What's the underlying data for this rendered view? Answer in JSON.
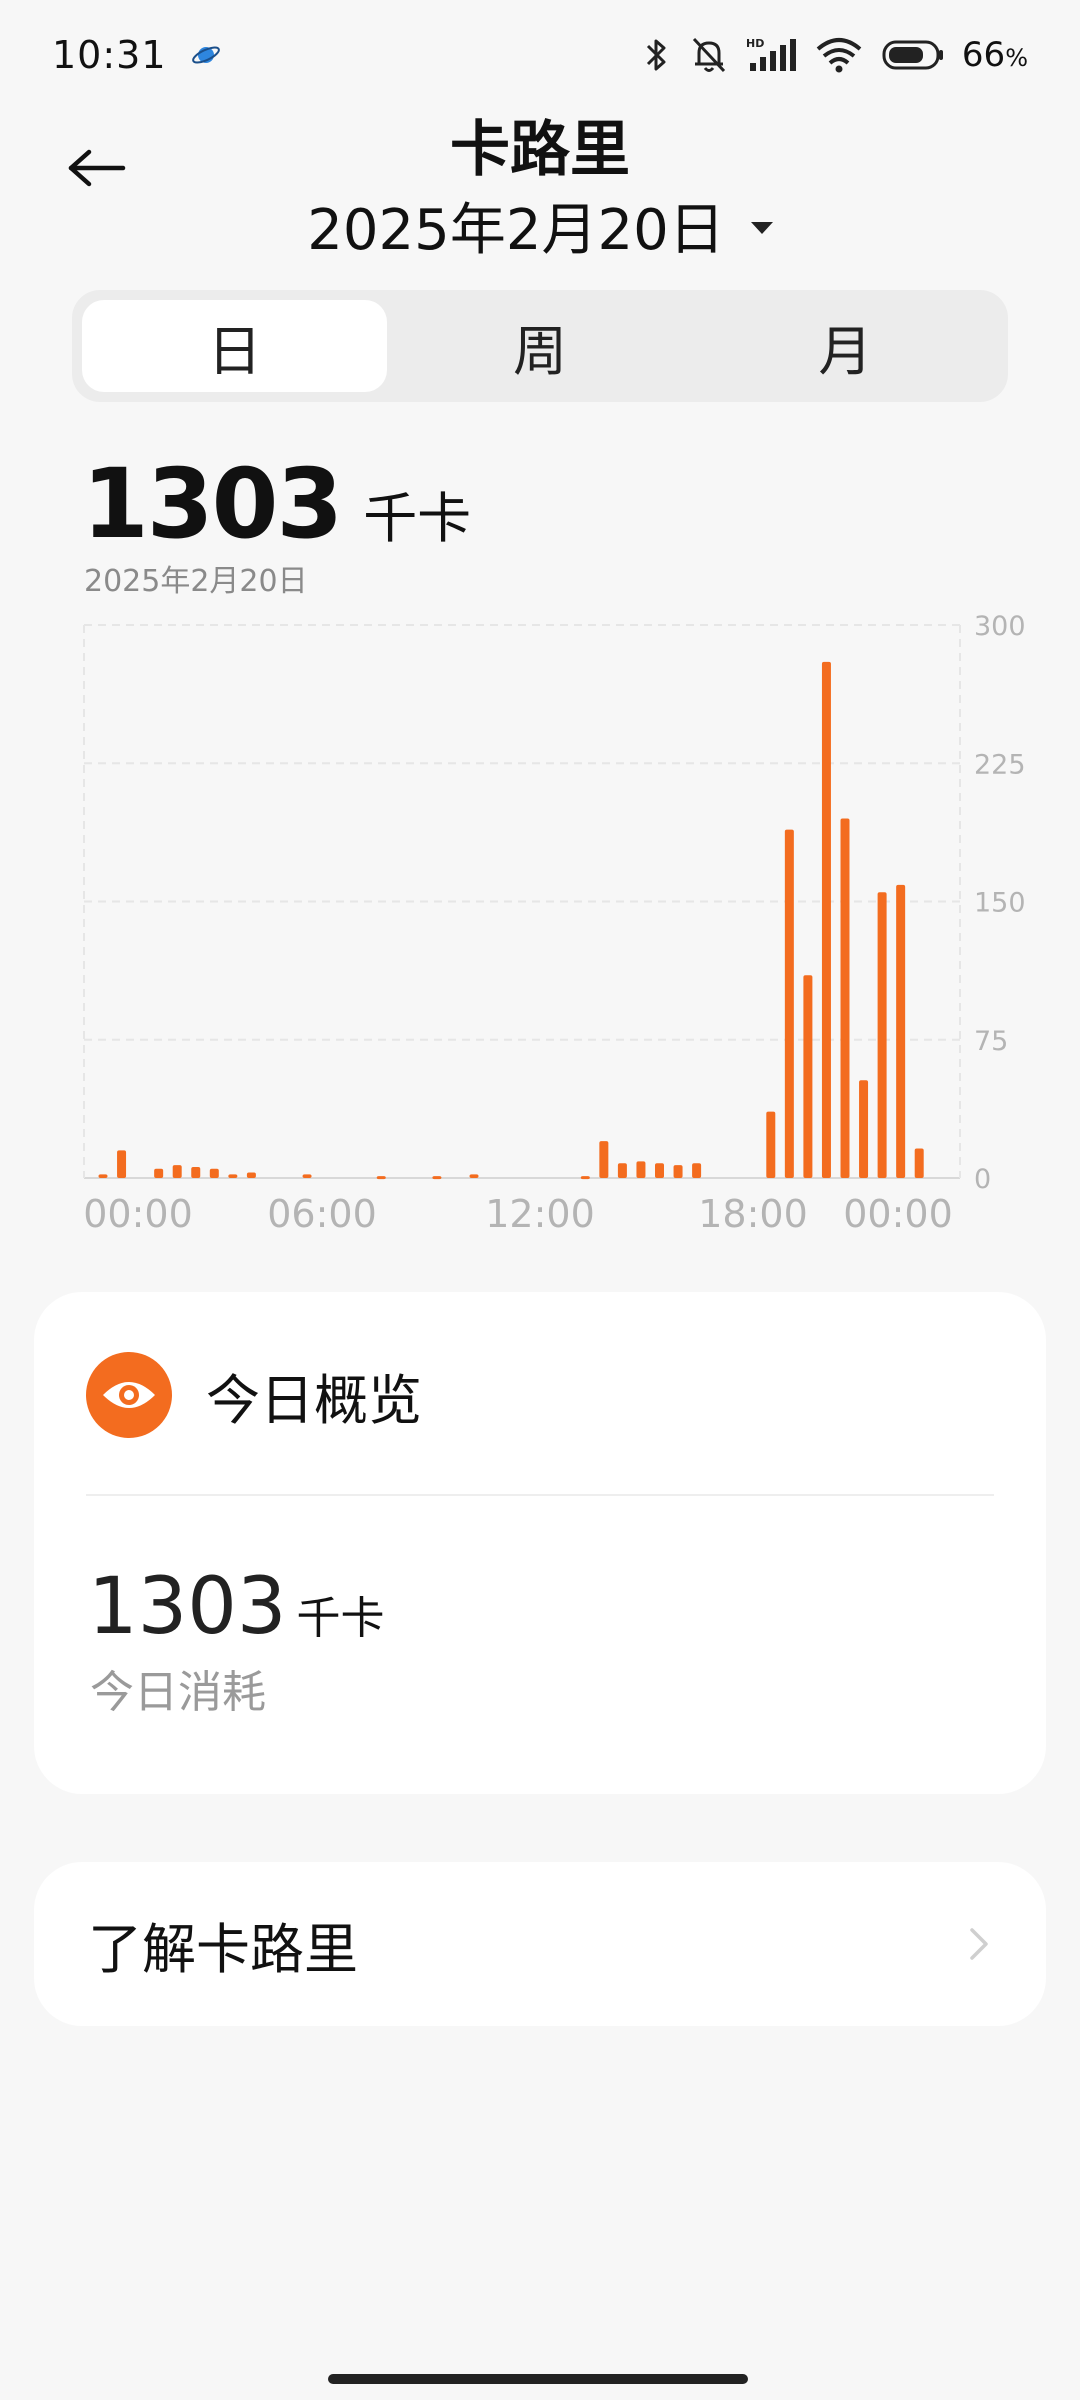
{
  "status_bar": {
    "time": "10:31",
    "battery": "66",
    "battery_unit": "%",
    "icons": [
      "planet-icon",
      "bluetooth-icon",
      "mute-bell-icon",
      "hd-signal-icon",
      "wifi-icon",
      "battery-icon"
    ]
  },
  "header": {
    "title": "卡路里",
    "date": "2025年2月20日"
  },
  "tabs": [
    {
      "label": "日",
      "active": true
    },
    {
      "label": "周",
      "active": false
    },
    {
      "label": "月",
      "active": false
    }
  ],
  "summary": {
    "value": "1303",
    "unit": "千卡",
    "date": "2025年2月20日"
  },
  "chart_data": {
    "type": "bar",
    "x_tick_labels": [
      "00:00",
      "06:00",
      "12:00",
      "18:00",
      "00:00"
    ],
    "y_tick_labels": [
      "300",
      "225",
      "150",
      "75",
      "0"
    ],
    "ylim": [
      0,
      300
    ],
    "x_unit_minutes_per_bar": 30,
    "bar_color": "#f36c1f",
    "grid": true,
    "y_axis_position": "right",
    "values": [
      2,
      15,
      0,
      5,
      7,
      6,
      5,
      2,
      3,
      0,
      0,
      2,
      0,
      0,
      0,
      1,
      0,
      0,
      1,
      0,
      2,
      0,
      0,
      0,
      0,
      0,
      1,
      20,
      8,
      9,
      8,
      7,
      8,
      0,
      0,
      0,
      36,
      189,
      110,
      280,
      195,
      53,
      155,
      159,
      16,
      0,
      0,
      0
    ]
  },
  "overview": {
    "title": "今日概览",
    "value": "1303",
    "unit": "千卡",
    "label": "今日消耗",
    "accent": "#f36c1f"
  },
  "learn": {
    "label": "了解卡路里"
  }
}
